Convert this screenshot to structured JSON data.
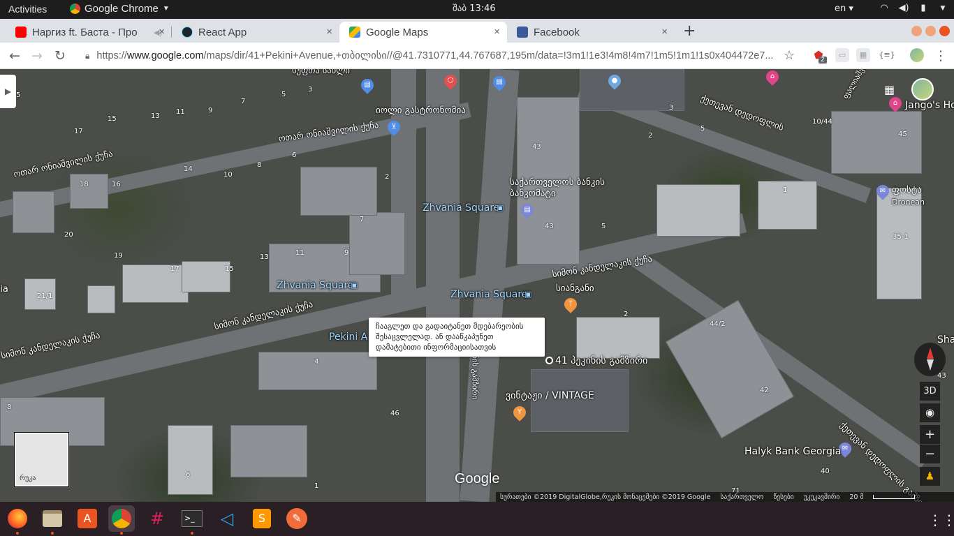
{
  "system": {
    "activities": "Activities",
    "app_name": "Google Chrome",
    "clock": "შაბ 13:46",
    "lang": "en"
  },
  "tabs": [
    {
      "title": "Наргиз ft. Баста - Про",
      "close": "×"
    },
    {
      "title": "React App",
      "close": "×"
    },
    {
      "title": "Google Maps",
      "close": "×"
    },
    {
      "title": "Facebook",
      "close": "×"
    }
  ],
  "new_tab": "+",
  "toolbar": {
    "url_scheme": "https://",
    "url_domain": "www.google.com",
    "url_path": "/maps/dir/41+Pekini+Avenue,+თბილისი//@41.7310771,44.767687,195m/data=!3m1!1e3!4m8!4m7!1m5!1m1!1s0x404472e7...",
    "ext_badge": "2",
    "ext_bracket": "{≡}"
  },
  "map": {
    "streets": [
      "სუფთა სახლი",
      "იოლი გასტრონომია",
      "ოთარ ონიაშვილის ქუჩა",
      "ოთარ ონიაშვილის ქუჩა",
      "სიმონ კანდელაკის ქუჩა",
      "სიმონ კანდელაკის ქუჩა",
      "სიმონ კანდელაკის ქუჩა",
      "ქეთევან დედოფლის გამზირი",
      "ფალიაშვილის ქ.",
      "პეკინის გამზირი",
      "ქეთევან დედოფლის"
    ],
    "transit": [
      "Zhvania Square",
      "Zhvania Square",
      "Zhvania Square",
      "Pekini A"
    ],
    "places": {
      "bank": "საქართველოს ბანკის ბანკომატი",
      "restaurant": "სიანგანი",
      "vintage": "ვინტაჟი / VINTAGE",
      "address": "41 პეკინის გამზირი",
      "post": "ფოსტა",
      "post_sub": "Dronean",
      "halyk": "Halyk Bank Georgia",
      "jango": "Jango's Ho",
      "sha": "Sha",
      "left_cut": "dia"
    },
    "numbers": [
      "5",
      "3",
      "5",
      "13",
      "11",
      "9",
      "7",
      "17",
      "15",
      "14",
      "10",
      "8",
      "6",
      "2",
      "18",
      "16",
      "20",
      "19",
      "17",
      "15",
      "13",
      "11",
      "9",
      "7",
      "21/1",
      "4",
      "46",
      "6",
      "1",
      "8",
      "43",
      "43",
      "5",
      "2",
      "3",
      "5",
      "10/44",
      "45",
      "1",
      "35-1",
      "44/2",
      "42",
      "40",
      "2",
      "71",
      "43"
    ],
    "tooltip": "ჩააგლეთ და გადაიტანეთ მდებარეობის შესაცვლელად. ან დააწკაპუნეთ დამატებითი ინფორმაციისათვის",
    "minimap_label": "რუკა",
    "ctrl_3d": "3D",
    "zoom_in": "+",
    "zoom_out": "−",
    "logo": "Google",
    "attribution": [
      "სურათები ©2019 DigitalGlobe,რუკის მონაცემები ©2019 Google",
      "საქართველო",
      "წესები",
      "უკუკავშირი",
      "20 მ"
    ]
  },
  "dock": [
    "firefox",
    "files",
    "software",
    "chrome",
    "slack",
    "terminal",
    "vscode",
    "sublime",
    "inkscape"
  ]
}
